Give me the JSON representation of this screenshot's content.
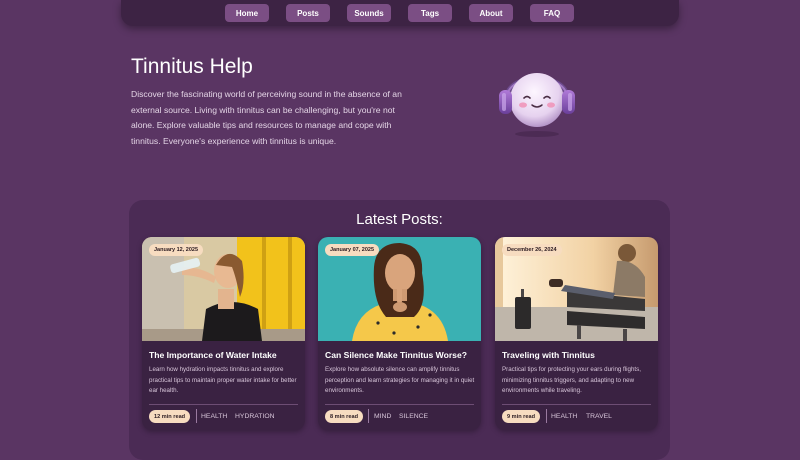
{
  "nav": {
    "items": [
      {
        "label": "Home"
      },
      {
        "label": "Posts"
      },
      {
        "label": "Sounds"
      },
      {
        "label": "Tags"
      },
      {
        "label": "About"
      },
      {
        "label": "FAQ"
      }
    ]
  },
  "hero": {
    "title": "Tinnitus Help",
    "description": "Discover the fascinating world of perceiving sound in the absence of an external source. Living with tinnitus can be challenging, but you're not alone. Explore valuable tips and resources to manage and cope with tinnitus. Everyone's experience with tinnitus is unique."
  },
  "latest": {
    "heading": "Latest Posts:",
    "posts": [
      {
        "date": "January 12, 2025",
        "title": "The Importance of Water Intake",
        "description": "Learn how hydration impacts tinnitus and explore practical tips to maintain proper water intake for better ear health.",
        "read_time": "12 min read",
        "tags": [
          "HEALTH",
          "HYDRATION"
        ]
      },
      {
        "date": "January 07, 2025",
        "title": "Can Silence Make Tinnitus Worse?",
        "description": "Explore how absolute silence can amplify tinnitus perception and learn strategies for managing it in quiet environments.",
        "read_time": "8 min read",
        "tags": [
          "MIND",
          "SILENCE"
        ]
      },
      {
        "date": "December 26, 2024",
        "title": "Traveling with Tinnitus",
        "description": "Practical tips for protecting your ears during flights, minimizing tinnitus triggers, and adapting to new environments while traveling.",
        "read_time": "9 min read",
        "tags": [
          "HEALTH",
          "TRAVEL"
        ]
      }
    ]
  },
  "colors": {
    "background": "#5a3563",
    "navbar": "#3d2344",
    "nav_button": "#7b4e84",
    "panel": "#4b2b55",
    "card": "#3a2242",
    "badge": "#f7dcc0"
  },
  "icons": {
    "mascot": "headphone-mascot-icon"
  }
}
